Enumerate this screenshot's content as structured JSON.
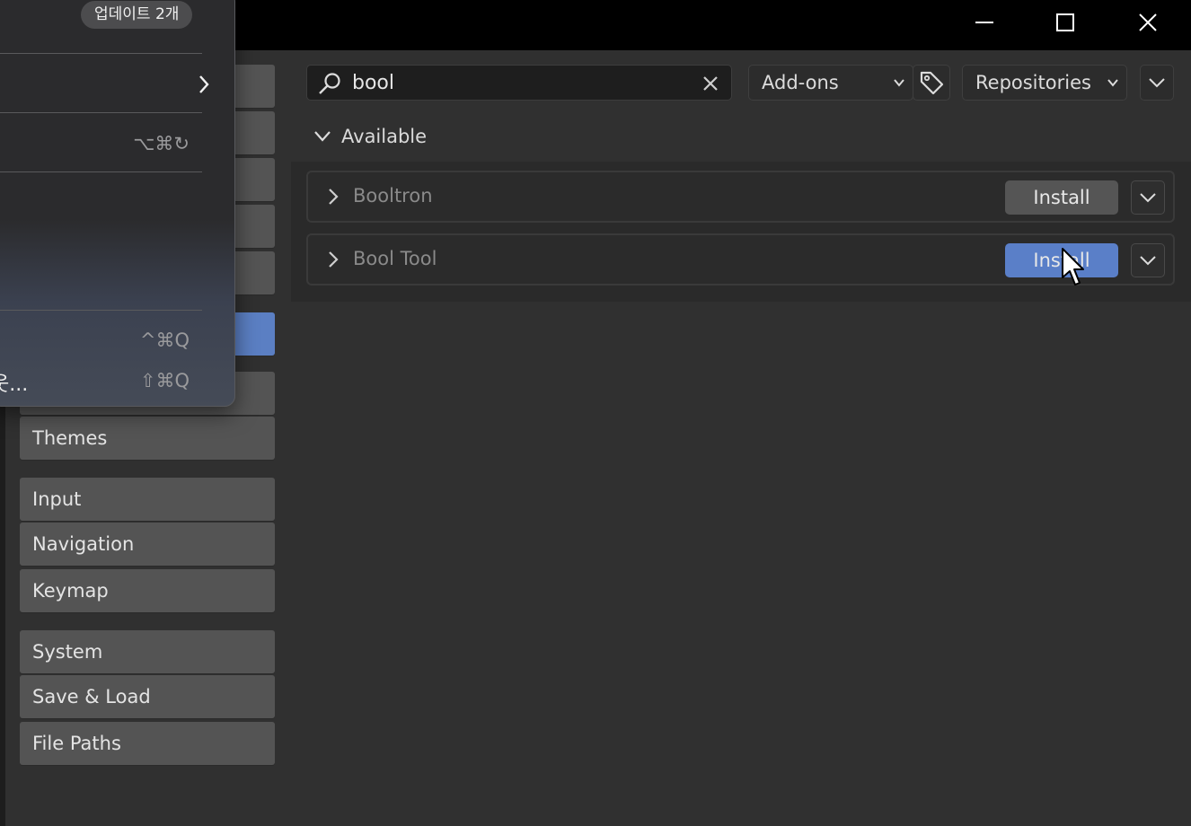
{
  "window": {
    "controls": {
      "minimize": "minimize-icon",
      "maximize": "maximize-icon",
      "close": "close-icon"
    }
  },
  "navigation": {
    "items": [
      {
        "label": ""
      },
      {
        "label": ""
      },
      {
        "label": ""
      },
      {
        "label": ""
      },
      {
        "label": ""
      },
      {
        "label": "",
        "active": true
      },
      {
        "label": ""
      },
      {
        "label": "Themes"
      },
      {
        "label": "Input"
      },
      {
        "label": "Navigation"
      },
      {
        "label": "Keymap"
      },
      {
        "label": "System"
      },
      {
        "label": "Save & Load"
      },
      {
        "label": "File Paths"
      }
    ]
  },
  "toolbar": {
    "search_value": "bool",
    "type_filter": "Add-ons",
    "repositories": "Repositories"
  },
  "section": {
    "title": "Available",
    "extensions": [
      {
        "name": "Booltron",
        "action": "Install"
      },
      {
        "name": "Bool Tool",
        "action": "Install",
        "hovered": true
      }
    ]
  },
  "overlay_menu": {
    "badge": "업데이트 2개",
    "items": [
      {
        "label": "",
        "shortcut": "",
        "has_submenu": true
      },
      {
        "label": "",
        "shortcut": "⌥⌘↻"
      },
      {
        "label": "",
        "shortcut": "^⌘Q"
      },
      {
        "label": "웃...",
        "shortcut": "⇧⌘Q"
      }
    ]
  },
  "colors": {
    "active_blue": "#5b7fc3",
    "button_grey": "#545454",
    "background": "#303030"
  }
}
